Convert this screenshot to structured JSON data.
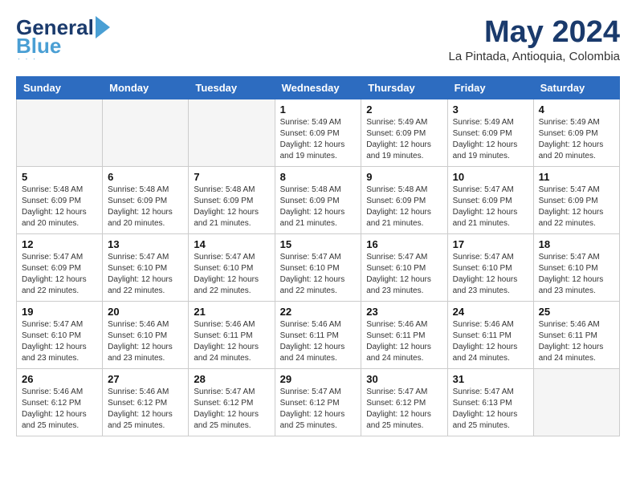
{
  "header": {
    "logo_general": "General",
    "logo_blue": "Blue",
    "month_title": "May 2024",
    "location": "La Pintada, Antioquia, Colombia"
  },
  "days_of_week": [
    "Sunday",
    "Monday",
    "Tuesday",
    "Wednesday",
    "Thursday",
    "Friday",
    "Saturday"
  ],
  "weeks": [
    {
      "days": [
        {
          "number": "",
          "info": "",
          "empty": true
        },
        {
          "number": "",
          "info": "",
          "empty": true
        },
        {
          "number": "",
          "info": "",
          "empty": true
        },
        {
          "number": "1",
          "info": "Sunrise: 5:49 AM\nSunset: 6:09 PM\nDaylight: 12 hours\nand 19 minutes.",
          "empty": false
        },
        {
          "number": "2",
          "info": "Sunrise: 5:49 AM\nSunset: 6:09 PM\nDaylight: 12 hours\nand 19 minutes.",
          "empty": false
        },
        {
          "number": "3",
          "info": "Sunrise: 5:49 AM\nSunset: 6:09 PM\nDaylight: 12 hours\nand 19 minutes.",
          "empty": false
        },
        {
          "number": "4",
          "info": "Sunrise: 5:49 AM\nSunset: 6:09 PM\nDaylight: 12 hours\nand 20 minutes.",
          "empty": false
        }
      ]
    },
    {
      "days": [
        {
          "number": "5",
          "info": "Sunrise: 5:48 AM\nSunset: 6:09 PM\nDaylight: 12 hours\nand 20 minutes.",
          "empty": false
        },
        {
          "number": "6",
          "info": "Sunrise: 5:48 AM\nSunset: 6:09 PM\nDaylight: 12 hours\nand 20 minutes.",
          "empty": false
        },
        {
          "number": "7",
          "info": "Sunrise: 5:48 AM\nSunset: 6:09 PM\nDaylight: 12 hours\nand 21 minutes.",
          "empty": false
        },
        {
          "number": "8",
          "info": "Sunrise: 5:48 AM\nSunset: 6:09 PM\nDaylight: 12 hours\nand 21 minutes.",
          "empty": false
        },
        {
          "number": "9",
          "info": "Sunrise: 5:48 AM\nSunset: 6:09 PM\nDaylight: 12 hours\nand 21 minutes.",
          "empty": false
        },
        {
          "number": "10",
          "info": "Sunrise: 5:47 AM\nSunset: 6:09 PM\nDaylight: 12 hours\nand 21 minutes.",
          "empty": false
        },
        {
          "number": "11",
          "info": "Sunrise: 5:47 AM\nSunset: 6:09 PM\nDaylight: 12 hours\nand 22 minutes.",
          "empty": false
        }
      ]
    },
    {
      "days": [
        {
          "number": "12",
          "info": "Sunrise: 5:47 AM\nSunset: 6:09 PM\nDaylight: 12 hours\nand 22 minutes.",
          "empty": false
        },
        {
          "number": "13",
          "info": "Sunrise: 5:47 AM\nSunset: 6:10 PM\nDaylight: 12 hours\nand 22 minutes.",
          "empty": false
        },
        {
          "number": "14",
          "info": "Sunrise: 5:47 AM\nSunset: 6:10 PM\nDaylight: 12 hours\nand 22 minutes.",
          "empty": false
        },
        {
          "number": "15",
          "info": "Sunrise: 5:47 AM\nSunset: 6:10 PM\nDaylight: 12 hours\nand 22 minutes.",
          "empty": false
        },
        {
          "number": "16",
          "info": "Sunrise: 5:47 AM\nSunset: 6:10 PM\nDaylight: 12 hours\nand 23 minutes.",
          "empty": false
        },
        {
          "number": "17",
          "info": "Sunrise: 5:47 AM\nSunset: 6:10 PM\nDaylight: 12 hours\nand 23 minutes.",
          "empty": false
        },
        {
          "number": "18",
          "info": "Sunrise: 5:47 AM\nSunset: 6:10 PM\nDaylight: 12 hours\nand 23 minutes.",
          "empty": false
        }
      ]
    },
    {
      "days": [
        {
          "number": "19",
          "info": "Sunrise: 5:47 AM\nSunset: 6:10 PM\nDaylight: 12 hours\nand 23 minutes.",
          "empty": false
        },
        {
          "number": "20",
          "info": "Sunrise: 5:46 AM\nSunset: 6:10 PM\nDaylight: 12 hours\nand 23 minutes.",
          "empty": false
        },
        {
          "number": "21",
          "info": "Sunrise: 5:46 AM\nSunset: 6:11 PM\nDaylight: 12 hours\nand 24 minutes.",
          "empty": false
        },
        {
          "number": "22",
          "info": "Sunrise: 5:46 AM\nSunset: 6:11 PM\nDaylight: 12 hours\nand 24 minutes.",
          "empty": false
        },
        {
          "number": "23",
          "info": "Sunrise: 5:46 AM\nSunset: 6:11 PM\nDaylight: 12 hours\nand 24 minutes.",
          "empty": false
        },
        {
          "number": "24",
          "info": "Sunrise: 5:46 AM\nSunset: 6:11 PM\nDaylight: 12 hours\nand 24 minutes.",
          "empty": false
        },
        {
          "number": "25",
          "info": "Sunrise: 5:46 AM\nSunset: 6:11 PM\nDaylight: 12 hours\nand 24 minutes.",
          "empty": false
        }
      ]
    },
    {
      "days": [
        {
          "number": "26",
          "info": "Sunrise: 5:46 AM\nSunset: 6:12 PM\nDaylight: 12 hours\nand 25 minutes.",
          "empty": false
        },
        {
          "number": "27",
          "info": "Sunrise: 5:46 AM\nSunset: 6:12 PM\nDaylight: 12 hours\nand 25 minutes.",
          "empty": false
        },
        {
          "number": "28",
          "info": "Sunrise: 5:47 AM\nSunset: 6:12 PM\nDaylight: 12 hours\nand 25 minutes.",
          "empty": false
        },
        {
          "number": "29",
          "info": "Sunrise: 5:47 AM\nSunset: 6:12 PM\nDaylight: 12 hours\nand 25 minutes.",
          "empty": false
        },
        {
          "number": "30",
          "info": "Sunrise: 5:47 AM\nSunset: 6:12 PM\nDaylight: 12 hours\nand 25 minutes.",
          "empty": false
        },
        {
          "number": "31",
          "info": "Sunrise: 5:47 AM\nSunset: 6:13 PM\nDaylight: 12 hours\nand 25 minutes.",
          "empty": false
        },
        {
          "number": "",
          "info": "",
          "empty": true
        }
      ]
    }
  ]
}
